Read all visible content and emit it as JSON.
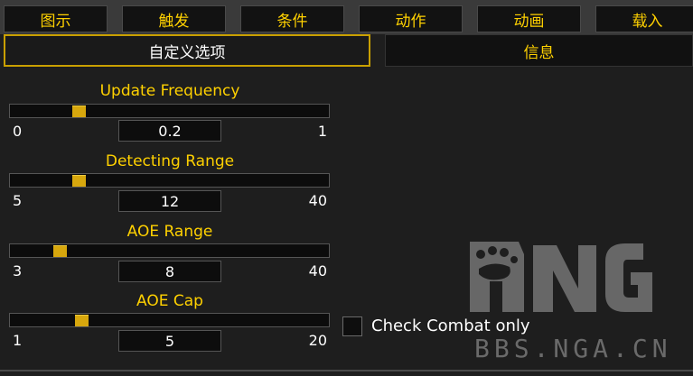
{
  "top_tabs": [
    "图示",
    "触发",
    "条件",
    "动作",
    "动画",
    "载入"
  ],
  "sub_tabs": {
    "options": "自定义选项",
    "info": "信息"
  },
  "sliders": [
    {
      "title": "Update Frequency",
      "min": "0",
      "max": "1",
      "value": "0.2",
      "level": 0.2
    },
    {
      "title": "Detecting Range",
      "min": "5",
      "max": "40",
      "value": "12",
      "level": 0.2
    },
    {
      "title": "AOE Range",
      "min": "3",
      "max": "40",
      "value": "8",
      "level": 0.14
    },
    {
      "title": "AOE Cap",
      "min": "1",
      "max": "20",
      "value": "5",
      "level": 0.21
    }
  ],
  "check_combat": {
    "label": "Check Combat only",
    "checked": false
  },
  "watermark": {
    "text": "BBS.NGA.CN"
  },
  "colors": {
    "accent": "#ffd100",
    "thumb": "#d7a70d",
    "active_border": "#c9a000"
  }
}
